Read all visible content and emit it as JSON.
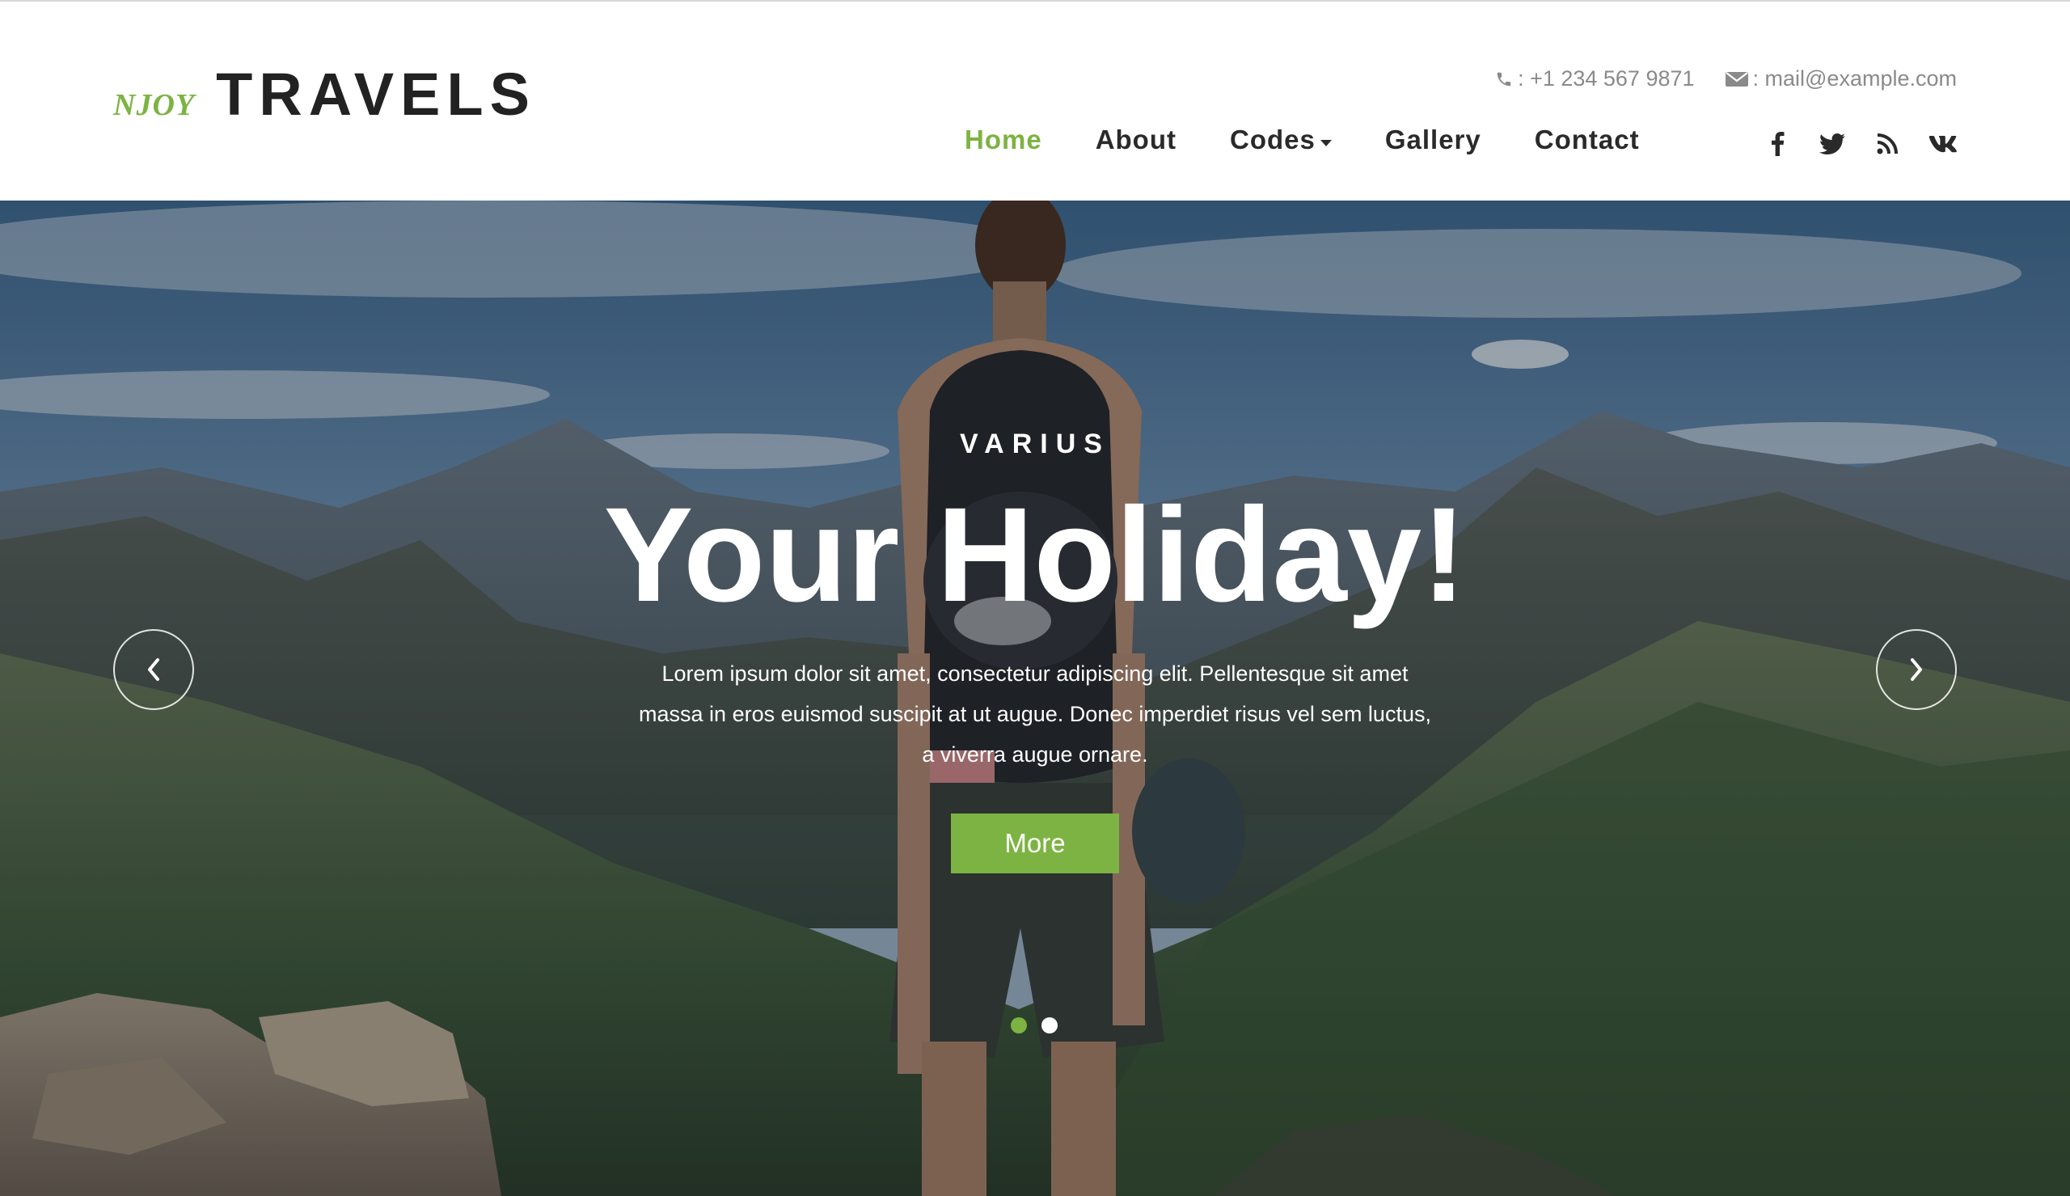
{
  "brand": {
    "small": "NJOY",
    "big": "TRAVELS",
    "accent_color": "#7cb342"
  },
  "contact": {
    "phone": ": +1 234 567 9871",
    "email": ": mail@example.com",
    "phone_icon": "phone-icon",
    "email_icon": "envelope-icon"
  },
  "nav": {
    "items": [
      {
        "label": "Home",
        "active": true
      },
      {
        "label": "About"
      },
      {
        "label": "Codes",
        "dropdown": true
      },
      {
        "label": "Gallery"
      },
      {
        "label": "Contact"
      }
    ]
  },
  "social": [
    "facebook-icon",
    "twitter-icon",
    "rss-icon",
    "vk-icon"
  ],
  "hero": {
    "kicker": "VARIUS",
    "headline": "Your Holiday!",
    "description": "Lorem ipsum dolor sit amet, consectetur adipiscing elit. Pellentesque sit amet massa in eros euismod suscipit at ut augue. Donec imperdiet risus vel sem luctus, a viverra augue ornare.",
    "button_label": "More",
    "slides": 2,
    "active_slide": 1
  }
}
